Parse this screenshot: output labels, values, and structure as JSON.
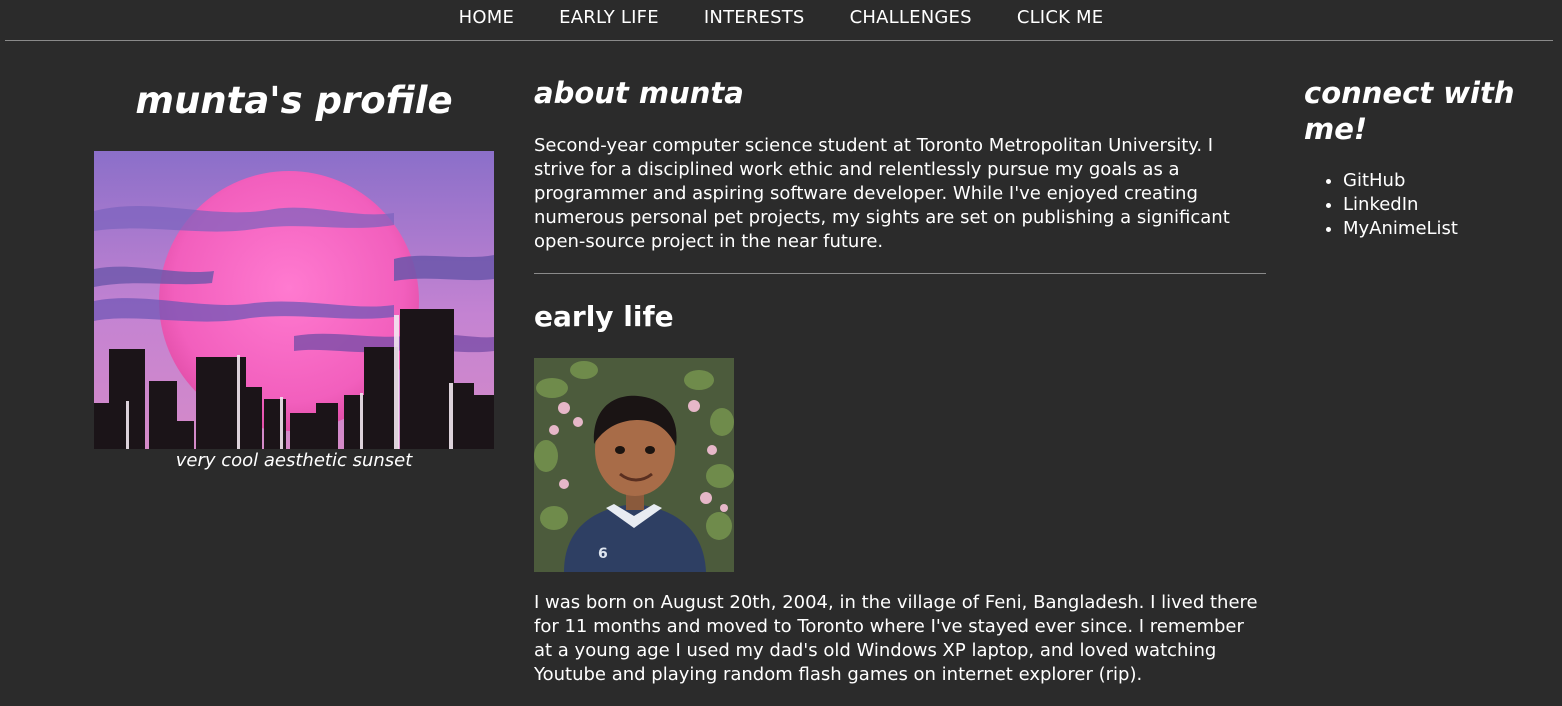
{
  "nav": {
    "items": [
      "HOME",
      "EARLY LIFE",
      "INTERESTS",
      "CHALLENGES",
      "CLICK ME"
    ]
  },
  "profile": {
    "title": "munta's profile",
    "image_icon": "sunset-cityscape-image",
    "caption": "very cool aesthetic sunset"
  },
  "about": {
    "title": "about munta",
    "text": "Second-year computer science student at Toronto Metropolitan University. I strive for a disciplined work ethic and relentlessly pursue my goals as a programmer and aspiring software developer. While I've enjoyed creating numerous personal pet projects, my sights are set on publishing a significant open-source project in the near future."
  },
  "early_life": {
    "title": "early life",
    "image_icon": "childhood-photo",
    "text": "I was born on August 20th, 2004, in the village of Feni, Bangladesh. I lived there for 11 months and moved to Toronto where I've stayed ever since. I remember at a young age I used my dad's old Windows XP laptop, and loved watching Youtube and playing random flash games on internet explorer (rip)."
  },
  "connect": {
    "title": "connect with me!",
    "links": [
      "GitHub",
      "LinkedIn",
      "MyAnimeList"
    ]
  },
  "colors": {
    "background": "#2b2b2b",
    "text": "#ffffff",
    "rule": "#8a8a8a"
  }
}
